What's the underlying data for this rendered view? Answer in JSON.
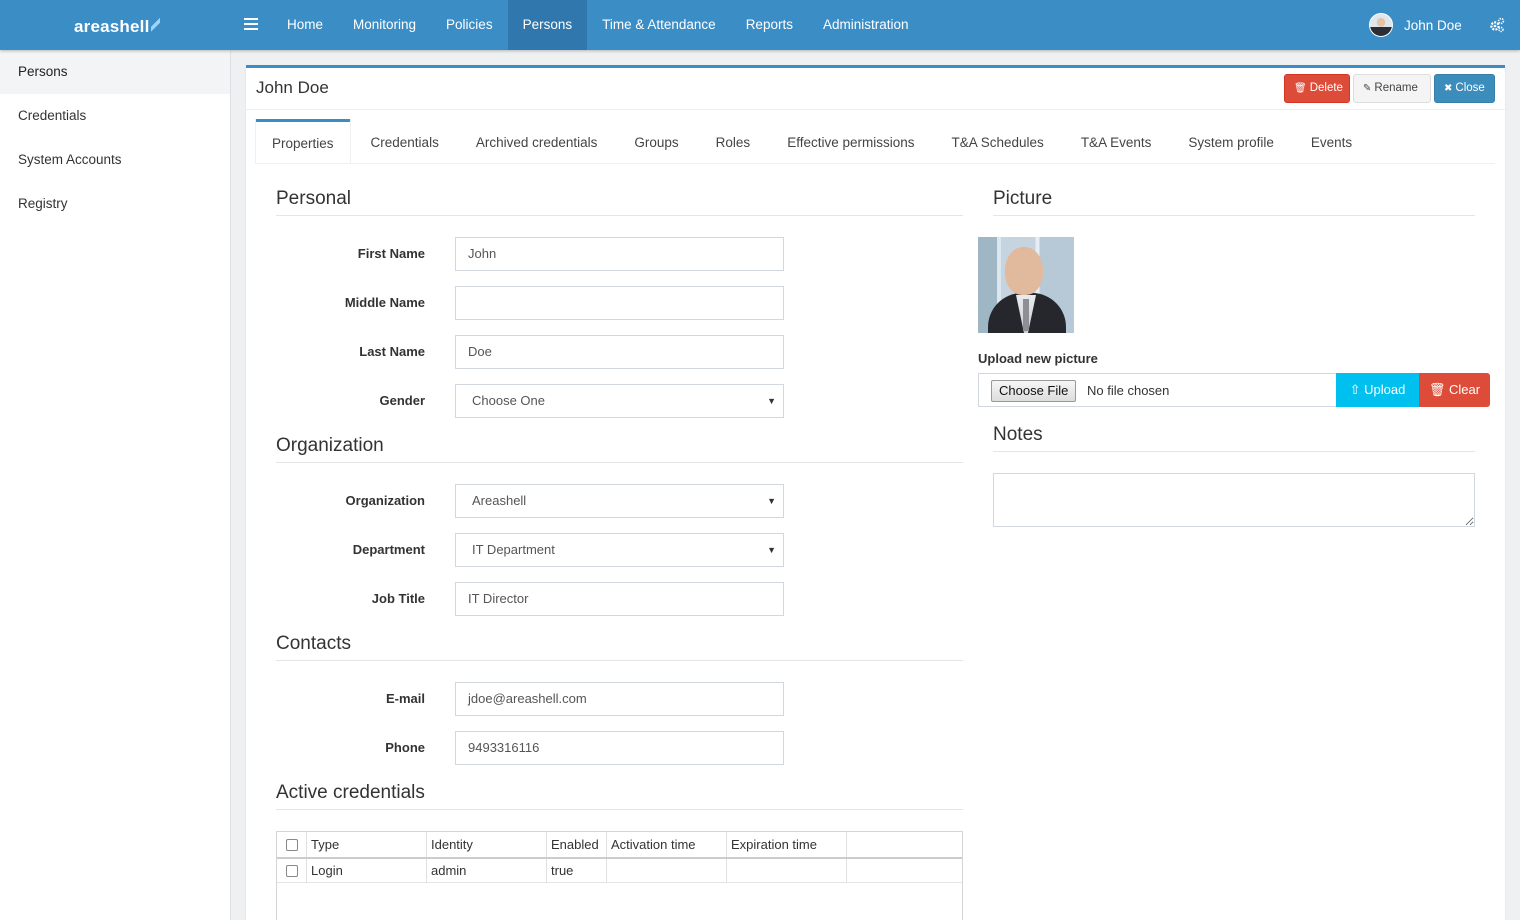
{
  "brand": "areashell",
  "nav": {
    "items": [
      "Home",
      "Monitoring",
      "Policies",
      "Persons",
      "Time & Attendance",
      "Reports",
      "Administration"
    ],
    "active": "Persons",
    "user_name": "John Doe"
  },
  "sidebar": {
    "items": [
      "Persons",
      "Credentials",
      "System Accounts",
      "Registry"
    ],
    "active": "Persons"
  },
  "panel": {
    "title": "John Doe",
    "buttons": {
      "delete": "Delete",
      "rename": "Rename",
      "close": "Close"
    }
  },
  "tabs": [
    "Properties",
    "Credentials",
    "Archived credentials",
    "Groups",
    "Roles",
    "Effective permissions",
    "T&A Schedules",
    "T&A Events",
    "System profile",
    "Events"
  ],
  "active_tab": "Properties",
  "personal": {
    "heading": "Personal",
    "first_name_label": "First Name",
    "first_name": "John",
    "middle_name_label": "Middle Name",
    "middle_name": "",
    "last_name_label": "Last Name",
    "last_name": "Doe",
    "gender_label": "Gender",
    "gender": "Choose One"
  },
  "organization": {
    "heading": "Organization",
    "organization_label": "Organization",
    "organization": "Areashell",
    "department_label": "Department",
    "department": "IT Department",
    "job_title_label": "Job Title",
    "job_title": "IT Director"
  },
  "contacts": {
    "heading": "Contacts",
    "email_label": "E-mail",
    "email": "jdoe@areashell.com",
    "phone_label": "Phone",
    "phone": "9493316116"
  },
  "credentials": {
    "heading": "Active credentials",
    "columns": [
      "Type",
      "Identity",
      "Enabled",
      "Activation time",
      "Expiration time"
    ],
    "rows": [
      {
        "type": "Login",
        "identity": "admin",
        "enabled": "true",
        "activation": "",
        "expiration": ""
      }
    ]
  },
  "picture": {
    "heading": "Picture",
    "upload_label": "Upload new picture",
    "choose_file": "Choose File",
    "no_file": "No file chosen",
    "upload_btn": "Upload",
    "clear_btn": "Clear"
  },
  "notes": {
    "heading": "Notes",
    "value": ""
  },
  "colors": {
    "primary": "#3b8dc6",
    "danger": "#dd4b39",
    "info": "#00c0ef"
  }
}
